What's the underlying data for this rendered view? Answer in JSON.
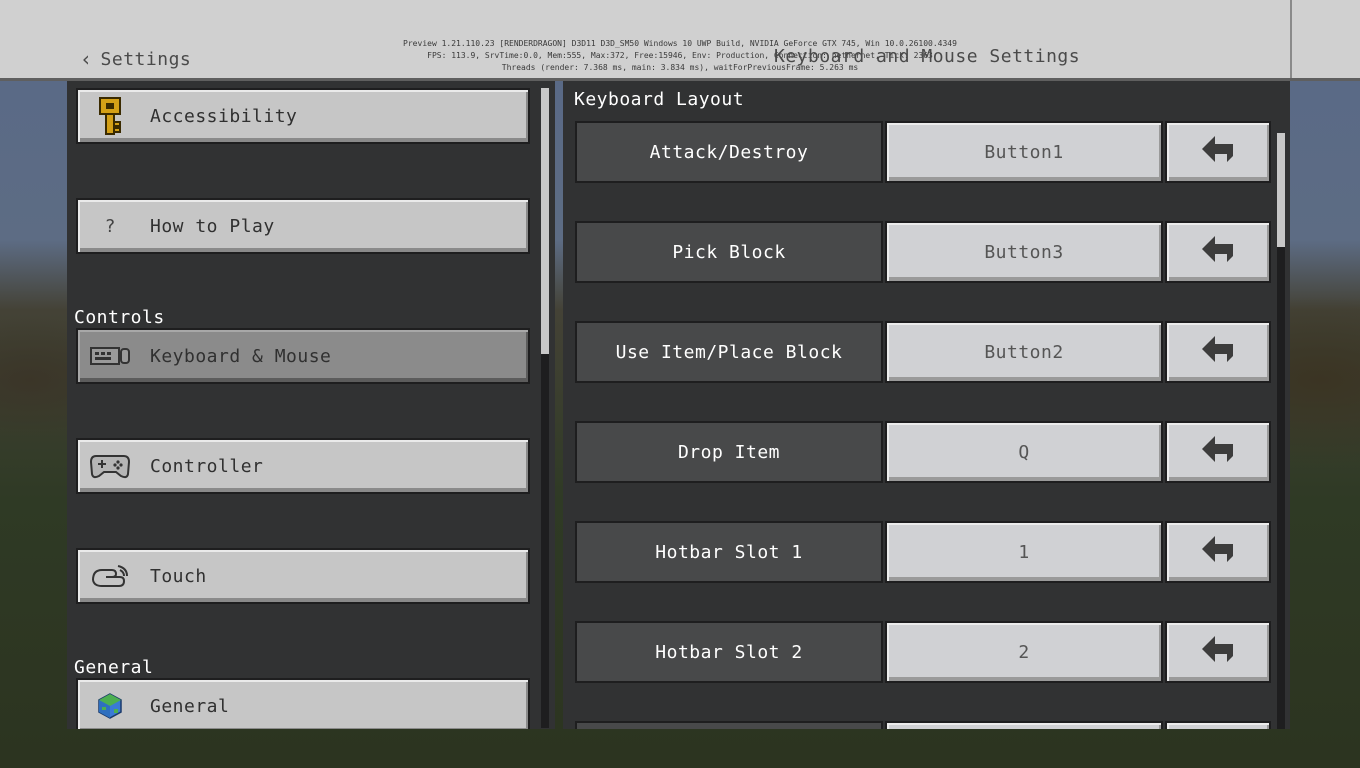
{
  "header": {
    "back_label": "Settings",
    "title": "Keyboard and Mouse Settings",
    "debug_lines": [
      "Preview 1.21.110.23 [RENDERDRAGON] D3D11 D3D_SM50 Windows 10 UWP Build, NVIDIA GeForce GTX 745, Win 10.0.26100.4349",
      "FPS: 113.9, SrvTime:0.0, Mem:555, Max:372, Free:15946, Env: Production, Connection: nethernet, Tick: 2363",
      "Threads (render: 7.368 ms, main: 3.834 ms), waitForPreviousFrame: 5.263 ms"
    ]
  },
  "sidebar": {
    "items": [
      {
        "label": "Accessibility",
        "icon": "key-icon"
      },
      {
        "label": "How to Play",
        "icon": "question-icon"
      }
    ],
    "controls_header": "Controls",
    "controls_items": [
      {
        "label": "Keyboard & Mouse",
        "icon": "keyboard-mouse-icon",
        "selected": true
      },
      {
        "label": "Controller",
        "icon": "controller-icon"
      },
      {
        "label": "Touch",
        "icon": "touch-icon"
      }
    ],
    "general_header": "General",
    "general_items": [
      {
        "label": "General",
        "icon": "globe-icon"
      }
    ]
  },
  "keyboard_layout": {
    "title": "Keyboard Layout",
    "rows": [
      {
        "action": "Attack/Destroy",
        "key": "Button1"
      },
      {
        "action": "Pick Block",
        "key": "Button3"
      },
      {
        "action": "Use Item/Place Block",
        "key": "Button2"
      },
      {
        "action": "Drop Item",
        "key": "Q"
      },
      {
        "action": "Hotbar Slot 1",
        "key": "1"
      },
      {
        "action": "Hotbar Slot 2",
        "key": "2"
      }
    ]
  },
  "colors": {
    "panel": "#313233",
    "button": "#c6c6c6",
    "selected": "#8b8b8b",
    "action_label": "#48494a"
  }
}
